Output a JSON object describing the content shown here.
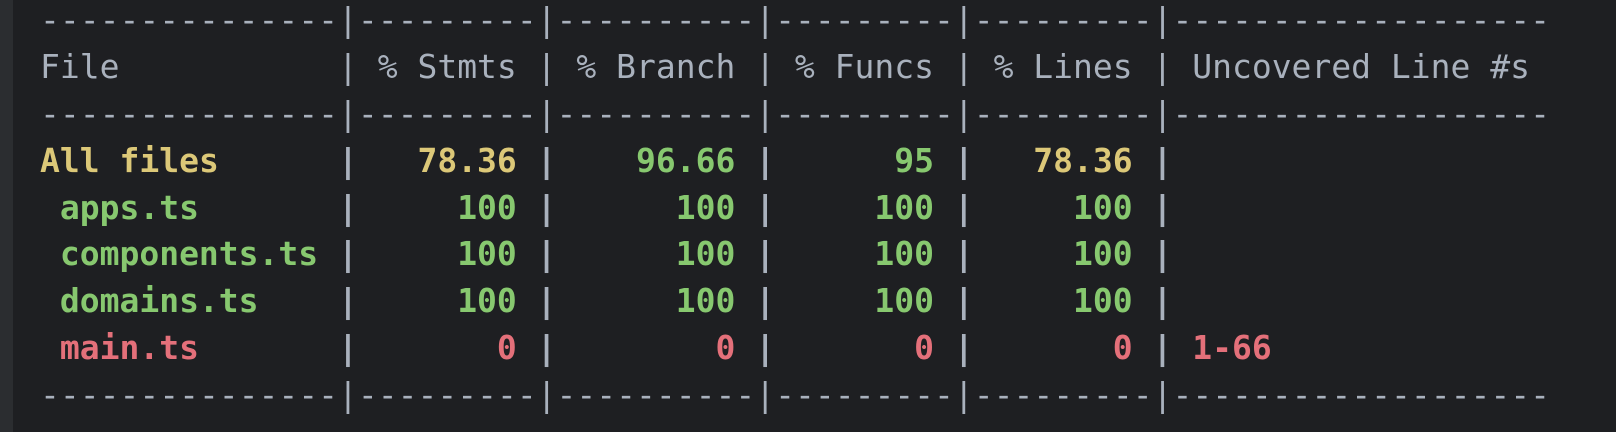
{
  "colors": {
    "background": "#1e1f22",
    "text": "#a9b1bd",
    "medium": "#dcc878",
    "high": "#87c86f",
    "low": "#e4707a"
  },
  "divider": "---------------|---------|----------|---------|---------|-------------------",
  "headers": [
    "File",
    "% Stmts",
    "% Branch",
    "% Funcs",
    "% Lines",
    "Uncovered Line #s"
  ],
  "rows": [
    {
      "file": "All files",
      "stmts": "78.36",
      "branch": "96.66",
      "funcs": "95",
      "lines": "78.36",
      "uncovered": "",
      "levels": [
        "medium",
        "medium",
        "high",
        "high",
        "medium",
        "medium"
      ]
    },
    {
      "file": "apps.ts",
      "stmts": "100",
      "branch": "100",
      "funcs": "100",
      "lines": "100",
      "uncovered": "",
      "levels": [
        "high",
        "high",
        "high",
        "high",
        "high",
        "high"
      ]
    },
    {
      "file": "components.ts",
      "stmts": "100",
      "branch": "100",
      "funcs": "100",
      "lines": "100",
      "uncovered": "",
      "levels": [
        "high",
        "high",
        "high",
        "high",
        "high",
        "high"
      ]
    },
    {
      "file": "domains.ts",
      "stmts": "100",
      "branch": "100",
      "funcs": "100",
      "lines": "100",
      "uncovered": "",
      "levels": [
        "high",
        "high",
        "high",
        "high",
        "high",
        "high"
      ]
    },
    {
      "file": "main.ts",
      "stmts": "0",
      "branch": "0",
      "funcs": "0",
      "lines": "0",
      "uncovered": "1-66",
      "levels": [
        "low",
        "low",
        "low",
        "low",
        "low",
        "low"
      ]
    }
  ]
}
